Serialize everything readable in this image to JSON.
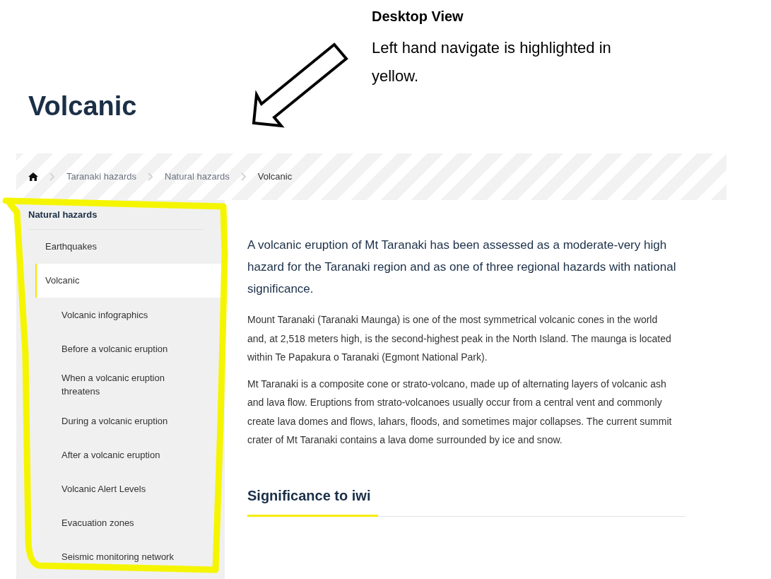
{
  "annotation": {
    "title": "Desktop View",
    "note": "Left hand navigate is highlighted in yellow."
  },
  "page_title": "Volcanic",
  "breadcrumb": [
    {
      "label": "Taranaki hazards",
      "current": false
    },
    {
      "label": "Natural hazards",
      "current": false
    },
    {
      "label": "Volcanic",
      "current": true
    }
  ],
  "sidebar": {
    "heading": "Natural hazards",
    "items": [
      {
        "label": "Earthquakes",
        "selected": false
      },
      {
        "label": "Volcanic",
        "selected": true,
        "children": [
          {
            "label": "Volcanic infographics"
          },
          {
            "label": "Before a volcanic eruption"
          },
          {
            "label": "When a volcanic eruption threatens"
          },
          {
            "label": "During a volcanic eruption"
          },
          {
            "label": "After a volcanic eruption"
          },
          {
            "label": "Volcanic Alert Levels"
          },
          {
            "label": "Evacuation zones"
          },
          {
            "label": "Seismic monitoring network"
          }
        ]
      }
    ]
  },
  "content": {
    "lead": "A volcanic eruption of Mt Taranaki has been assessed as a moderate-very high hazard for the Taranaki region and as one of three regional hazards with national significance.",
    "paragraphs": [
      "Mount Taranaki (Taranaki Maunga) is one of the most symmetrical volcanic cones in the world and, at 2,518 meters high, is the second-highest peak in the North Island. The maunga is located within Te Papakura o Taranaki (Egmont National Park).",
      "Mt Taranaki is a composite cone or strato-volcano, made up of alternating layers of volcanic ash and lava flow. Eruptions from strato-volcanoes usually occur from a central vent and commonly create lava domes and flows, lahars, floods, and sometimes major collapses. The current summit crater of Mt Taranaki contains a lava dome surrounded by ice and snow."
    ],
    "section_heading": "Significance to iwi"
  }
}
